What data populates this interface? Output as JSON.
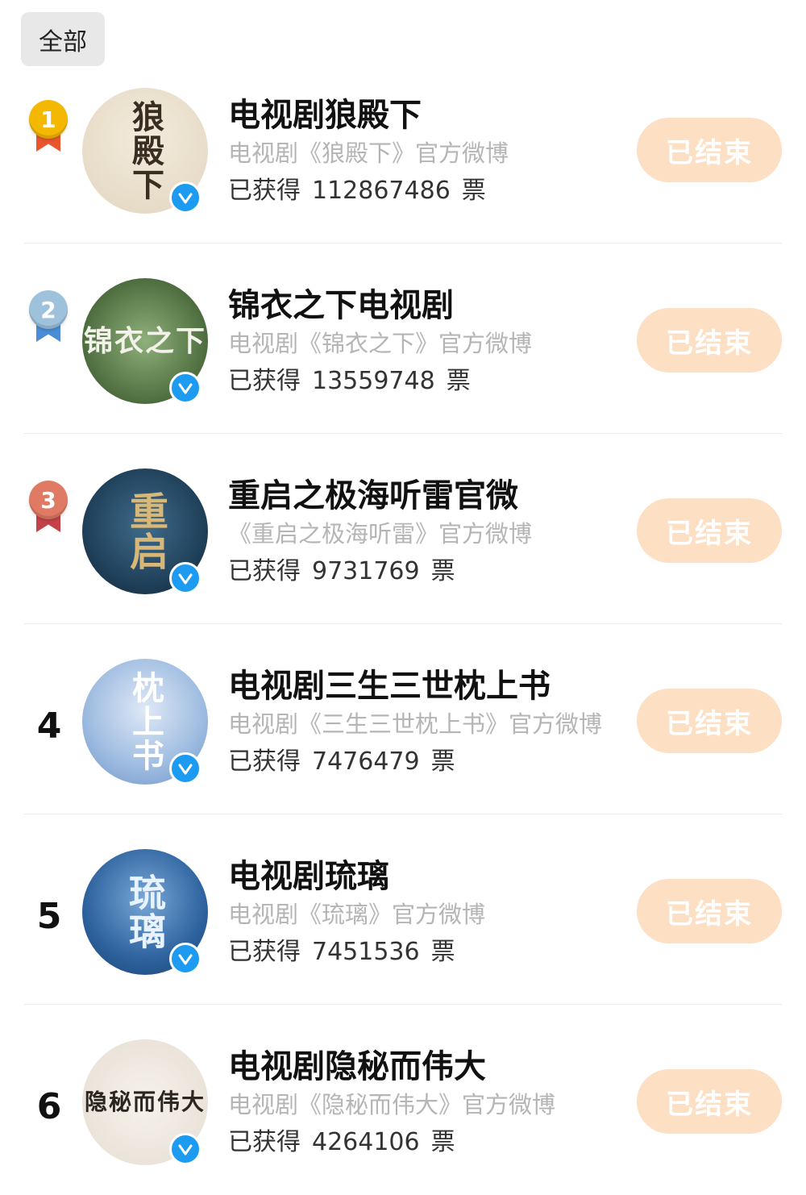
{
  "filter": {
    "label": "全部"
  },
  "items": [
    {
      "rank": "1",
      "medal": "gold",
      "avatar_text": "狼殿下",
      "title": "电视剧狼殿下",
      "subtitle": "电视剧《狼殿下》官方微博",
      "votes_prefix": "已获得",
      "votes": "112867486",
      "votes_unit": "票",
      "button": "已结束"
    },
    {
      "rank": "2",
      "medal": "silver",
      "avatar_text": "锦衣之下",
      "title": "锦衣之下电视剧",
      "subtitle": "电视剧《锦衣之下》官方微博",
      "votes_prefix": "已获得",
      "votes": "13559748",
      "votes_unit": "票",
      "button": "已结束"
    },
    {
      "rank": "3",
      "medal": "bronze",
      "avatar_text": "重启",
      "title": "重启之极海听雷官微",
      "subtitle": "《重启之极海听雷》官方微博",
      "votes_prefix": "已获得",
      "votes": "9731769",
      "votes_unit": "票",
      "button": "已结束"
    },
    {
      "rank": "4",
      "medal": "",
      "avatar_text": "枕上书",
      "title": "电视剧三生三世枕上书",
      "subtitle": "电视剧《三生三世枕上书》官方微博",
      "votes_prefix": "已获得",
      "votes": "7476479",
      "votes_unit": "票",
      "button": "已结束"
    },
    {
      "rank": "5",
      "medal": "",
      "avatar_text": "琉璃",
      "title": "电视剧琉璃",
      "subtitle": "电视剧《琉璃》官方微博",
      "votes_prefix": "已获得",
      "votes": "7451536",
      "votes_unit": "票",
      "button": "已结束"
    },
    {
      "rank": "6",
      "medal": "",
      "avatar_text": "隐秘而伟大",
      "title": "电视剧隐秘而伟大",
      "subtitle": "电视剧《隐秘而伟大》官方微博",
      "votes_prefix": "已获得",
      "votes": "4264106",
      "votes_unit": "票",
      "button": "已结束"
    }
  ],
  "colors": {
    "button_bg": "#fde0c4",
    "verified": "#1d9bf0",
    "medal_gold": "#f5b800",
    "medal_silver": "#9fc2dc",
    "medal_bronze": "#e07a64"
  }
}
